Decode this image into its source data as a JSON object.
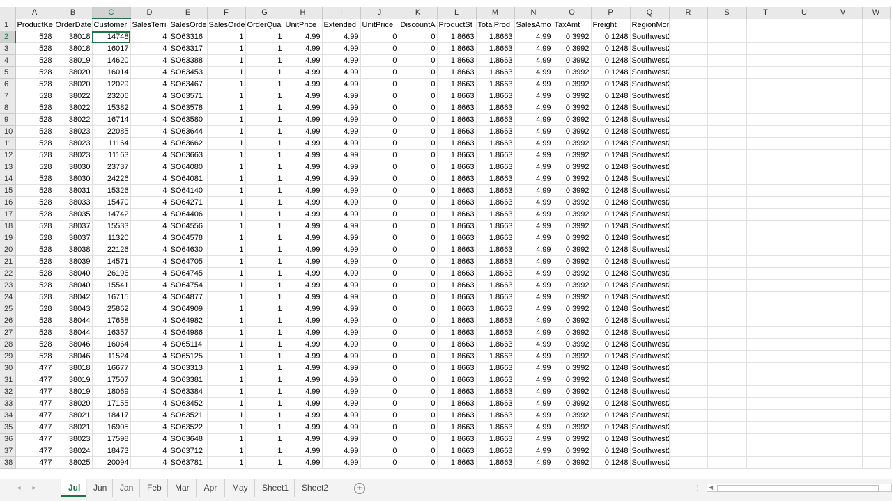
{
  "columns": [
    "A",
    "B",
    "C",
    "D",
    "E",
    "F",
    "G",
    "H",
    "I",
    "J",
    "K",
    "L",
    "M",
    "N",
    "O",
    "P",
    "Q",
    "R",
    "S",
    "T",
    "U",
    "V",
    "W"
  ],
  "selected_column": "C",
  "selected_row": 2,
  "headers": [
    "ProductKe",
    "OrderDate",
    "Customer",
    "SalesTerri",
    "SalesOrde",
    "SalesOrde",
    "OrderQua",
    "UnitPrice",
    "Extended",
    "UnitPrice",
    "DiscountA",
    "ProductSt",
    "TotalProd",
    "SalesAmo",
    "TaxAmt",
    "Freight",
    "RegionMonthID"
  ],
  "rows": [
    [
      528,
      38018,
      14748,
      4,
      "SO63316",
      1,
      1,
      4.99,
      4.99,
      0,
      0,
      1.8663,
      1.8663,
      4.99,
      0.3992,
      0.1248,
      "Southwest2"
    ],
    [
      528,
      38018,
      16017,
      4,
      "SO63317",
      1,
      1,
      4.99,
      4.99,
      0,
      0,
      1.8663,
      1.8663,
      4.99,
      0.3992,
      0.1248,
      "Southwest2"
    ],
    [
      528,
      38019,
      14620,
      4,
      "SO63388",
      1,
      1,
      4.99,
      4.99,
      0,
      0,
      1.8663,
      1.8663,
      4.99,
      0.3992,
      0.1248,
      "Southwest2"
    ],
    [
      528,
      38020,
      16014,
      4,
      "SO63453",
      1,
      1,
      4.99,
      4.99,
      0,
      0,
      1.8663,
      1.8663,
      4.99,
      0.3992,
      0.1248,
      "Southwest2"
    ],
    [
      528,
      38020,
      12029,
      4,
      "SO63467",
      1,
      1,
      4.99,
      4.99,
      0,
      0,
      1.8663,
      1.8663,
      4.99,
      0.3992,
      0.1248,
      "Southwest2"
    ],
    [
      528,
      38022,
      23206,
      4,
      "SO63571",
      1,
      1,
      4.99,
      4.99,
      0,
      0,
      1.8663,
      1.8663,
      4.99,
      0.3992,
      0.1248,
      "Southwest2"
    ],
    [
      528,
      38022,
      15382,
      4,
      "SO63578",
      1,
      1,
      4.99,
      4.99,
      0,
      0,
      1.8663,
      1.8663,
      4.99,
      0.3992,
      0.1248,
      "Southwest2"
    ],
    [
      528,
      38022,
      16714,
      4,
      "SO63580",
      1,
      1,
      4.99,
      4.99,
      0,
      0,
      1.8663,
      1.8663,
      4.99,
      0.3992,
      0.1248,
      "Southwest2"
    ],
    [
      528,
      38023,
      22085,
      4,
      "SO63644",
      1,
      1,
      4.99,
      4.99,
      0,
      0,
      1.8663,
      1.8663,
      4.99,
      0.3992,
      0.1248,
      "Southwest2"
    ],
    [
      528,
      38023,
      11164,
      4,
      "SO63662",
      1,
      1,
      4.99,
      4.99,
      0,
      0,
      1.8663,
      1.8663,
      4.99,
      0.3992,
      0.1248,
      "Southwest2"
    ],
    [
      528,
      38023,
      11163,
      4,
      "SO63663",
      1,
      1,
      4.99,
      4.99,
      0,
      0,
      1.8663,
      1.8663,
      4.99,
      0.3992,
      0.1248,
      "Southwest2"
    ],
    [
      528,
      38030,
      23737,
      4,
      "SO64080",
      1,
      1,
      4.99,
      4.99,
      0,
      0,
      1.8663,
      1.8663,
      4.99,
      0.3992,
      0.1248,
      "Southwest2"
    ],
    [
      528,
      38030,
      24226,
      4,
      "SO64081",
      1,
      1,
      4.99,
      4.99,
      0,
      0,
      1.8663,
      1.8663,
      4.99,
      0.3992,
      0.1248,
      "Southwest2"
    ],
    [
      528,
      38031,
      15326,
      4,
      "SO64140",
      1,
      1,
      4.99,
      4.99,
      0,
      0,
      1.8663,
      1.8663,
      4.99,
      0.3992,
      0.1248,
      "Southwest2"
    ],
    [
      528,
      38033,
      15470,
      4,
      "SO64271",
      1,
      1,
      4.99,
      4.99,
      0,
      0,
      1.8663,
      1.8663,
      4.99,
      0.3992,
      0.1248,
      "Southwest2"
    ],
    [
      528,
      38035,
      14742,
      4,
      "SO64406",
      1,
      1,
      4.99,
      4.99,
      0,
      0,
      1.8663,
      1.8663,
      4.99,
      0.3992,
      0.1248,
      "Southwest2"
    ],
    [
      528,
      38037,
      15533,
      4,
      "SO64556",
      1,
      1,
      4.99,
      4.99,
      0,
      0,
      1.8663,
      1.8663,
      4.99,
      0.3992,
      0.1248,
      "Southwest2"
    ],
    [
      528,
      38037,
      11320,
      4,
      "SO64578",
      1,
      1,
      4.99,
      4.99,
      0,
      0,
      1.8663,
      1.8663,
      4.99,
      0.3992,
      0.1248,
      "Southwest2"
    ],
    [
      528,
      38038,
      22126,
      4,
      "SO64630",
      1,
      1,
      4.99,
      4.99,
      0,
      0,
      1.8663,
      1.8663,
      4.99,
      0.3992,
      0.1248,
      "Southwest2"
    ],
    [
      528,
      38039,
      14571,
      4,
      "SO64705",
      1,
      1,
      4.99,
      4.99,
      0,
      0,
      1.8663,
      1.8663,
      4.99,
      0.3992,
      0.1248,
      "Southwest2"
    ],
    [
      528,
      38040,
      26196,
      4,
      "SO64745",
      1,
      1,
      4.99,
      4.99,
      0,
      0,
      1.8663,
      1.8663,
      4.99,
      0.3992,
      0.1248,
      "Southwest2"
    ],
    [
      528,
      38040,
      15541,
      4,
      "SO64754",
      1,
      1,
      4.99,
      4.99,
      0,
      0,
      1.8663,
      1.8663,
      4.99,
      0.3992,
      0.1248,
      "Southwest2"
    ],
    [
      528,
      38042,
      16715,
      4,
      "SO64877",
      1,
      1,
      4.99,
      4.99,
      0,
      0,
      1.8663,
      1.8663,
      4.99,
      0.3992,
      0.1248,
      "Southwest2"
    ],
    [
      528,
      38043,
      25862,
      4,
      "SO64909",
      1,
      1,
      4.99,
      4.99,
      0,
      0,
      1.8663,
      1.8663,
      4.99,
      0.3992,
      0.1248,
      "Southwest2"
    ],
    [
      528,
      38044,
      17658,
      4,
      "SO64982",
      1,
      1,
      4.99,
      4.99,
      0,
      0,
      1.8663,
      1.8663,
      4.99,
      0.3992,
      0.1248,
      "Southwest2"
    ],
    [
      528,
      38044,
      16357,
      4,
      "SO64986",
      1,
      1,
      4.99,
      4.99,
      0,
      0,
      1.8663,
      1.8663,
      4.99,
      0.3992,
      0.1248,
      "Southwest2"
    ],
    [
      528,
      38046,
      16064,
      4,
      "SO65114",
      1,
      1,
      4.99,
      4.99,
      0,
      0,
      1.8663,
      1.8663,
      4.99,
      0.3992,
      0.1248,
      "Southwest2"
    ],
    [
      528,
      38046,
      11524,
      4,
      "SO65125",
      1,
      1,
      4.99,
      4.99,
      0,
      0,
      1.8663,
      1.8663,
      4.99,
      0.3992,
      0.1248,
      "Southwest2"
    ],
    [
      477,
      38018,
      16677,
      4,
      "SO63313",
      1,
      1,
      4.99,
      4.99,
      0,
      0,
      1.8663,
      1.8663,
      4.99,
      0.3992,
      0.1248,
      "Southwest2"
    ],
    [
      477,
      38019,
      17507,
      4,
      "SO63381",
      1,
      1,
      4.99,
      4.99,
      0,
      0,
      1.8663,
      1.8663,
      4.99,
      0.3992,
      0.1248,
      "Southwest2"
    ],
    [
      477,
      38019,
      18069,
      4,
      "SO63384",
      1,
      1,
      4.99,
      4.99,
      0,
      0,
      1.8663,
      1.8663,
      4.99,
      0.3992,
      0.1248,
      "Southwest2"
    ],
    [
      477,
      38020,
      17155,
      4,
      "SO63452",
      1,
      1,
      4.99,
      4.99,
      0,
      0,
      1.8663,
      1.8663,
      4.99,
      0.3992,
      0.1248,
      "Southwest2"
    ],
    [
      477,
      38021,
      18417,
      4,
      "SO63521",
      1,
      1,
      4.99,
      4.99,
      0,
      0,
      1.8663,
      1.8663,
      4.99,
      0.3992,
      0.1248,
      "Southwest2"
    ],
    [
      477,
      38021,
      16905,
      4,
      "SO63522",
      1,
      1,
      4.99,
      4.99,
      0,
      0,
      1.8663,
      1.8663,
      4.99,
      0.3992,
      0.1248,
      "Southwest2"
    ],
    [
      477,
      38023,
      17598,
      4,
      "SO63648",
      1,
      1,
      4.99,
      4.99,
      0,
      0,
      1.8663,
      1.8663,
      4.99,
      0.3992,
      0.1248,
      "Southwest2"
    ],
    [
      477,
      38024,
      18473,
      4,
      "SO63712",
      1,
      1,
      4.99,
      4.99,
      0,
      0,
      1.8663,
      1.8663,
      4.99,
      0.3992,
      0.1248,
      "Southwest2"
    ],
    [
      477,
      38025,
      20094,
      4,
      "SO63781",
      1,
      1,
      4.99,
      4.99,
      0,
      0,
      1.8663,
      1.8663,
      4.99,
      0.3992,
      0.1248,
      "Southwest2"
    ]
  ],
  "sheet_tabs": [
    "Jul",
    "Jun",
    "Jan",
    "Feb",
    "Mar",
    "Apr",
    "May",
    "Sheet1",
    "Sheet2"
  ],
  "active_tab": "Jul",
  "icons": {
    "add_sheet": "plus-circle-icon",
    "nav_prev": "caret-left-icon",
    "nav_next": "caret-right-icon",
    "scroll_left": "caret-left-icon"
  },
  "colors": {
    "accent": "#217346",
    "grid": "#e1e1e1",
    "header_bg": "#e9e9e9"
  }
}
